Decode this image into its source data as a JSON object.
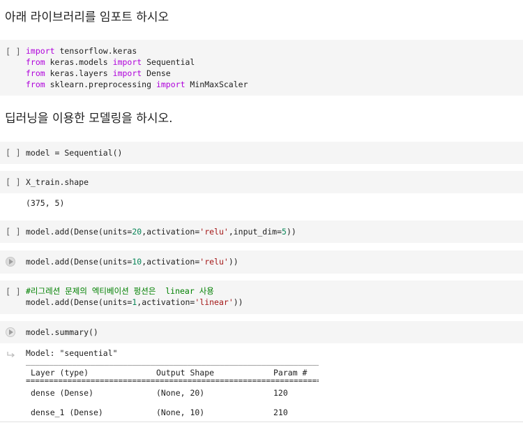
{
  "md1": "아래 라이브러리를 임포트 하시오",
  "md2": "딥러닝을 이용한 모델링을 하시오.",
  "bracket": "[ ]",
  "cell1": {
    "l1": {
      "kw": "import",
      "rest": " tensorflow.keras"
    },
    "l2": {
      "kw1": "from",
      "mid": " keras.models ",
      "kw2": "import",
      "rest": " Sequential"
    },
    "l3": {
      "kw1": "from",
      "mid": " keras.layers ",
      "kw2": "import",
      "rest": " Dense"
    },
    "l4": {
      "kw1": "from",
      "mid": " sklearn.preprocessing ",
      "kw2": "import",
      "rest": " MinMaxScaler"
    }
  },
  "cell2": "model = Sequential()",
  "cell3": "X_train.shape",
  "cell3_out": "(375, 5)",
  "cell4": {
    "a": "model.add(Dense(units=",
    "n1": "20",
    "b": ",activation=",
    "s1": "'relu'",
    "c": ",input_dim=",
    "n2": "5",
    "d": "))"
  },
  "cell5": {
    "a": "model.add(Dense(units=",
    "n1": "10",
    "b": ",activation=",
    "s1": "'relu'",
    "d": "))"
  },
  "cell6": {
    "comment": "#리그레션 문제의 엑티베이션 펑션은  linear 사용",
    "a": "model.add(Dense(units=",
    "n1": "1",
    "b": ",activation=",
    "s1": "'linear'",
    "d": "))"
  },
  "cell7": "model.summary()",
  "summary": {
    "model_line": "Model: \"sequential\"",
    "dash_rule": "_________________________________________________________________",
    "eq_rule": "=================================================================",
    "headers": [
      "Layer (type)",
      "Output Shape",
      "Param #"
    ],
    "rows": [
      [
        "dense (Dense)",
        "(None, 20)",
        "120"
      ],
      [
        "dense_1 (Dense)",
        "(None, 10)",
        "210"
      ]
    ]
  }
}
